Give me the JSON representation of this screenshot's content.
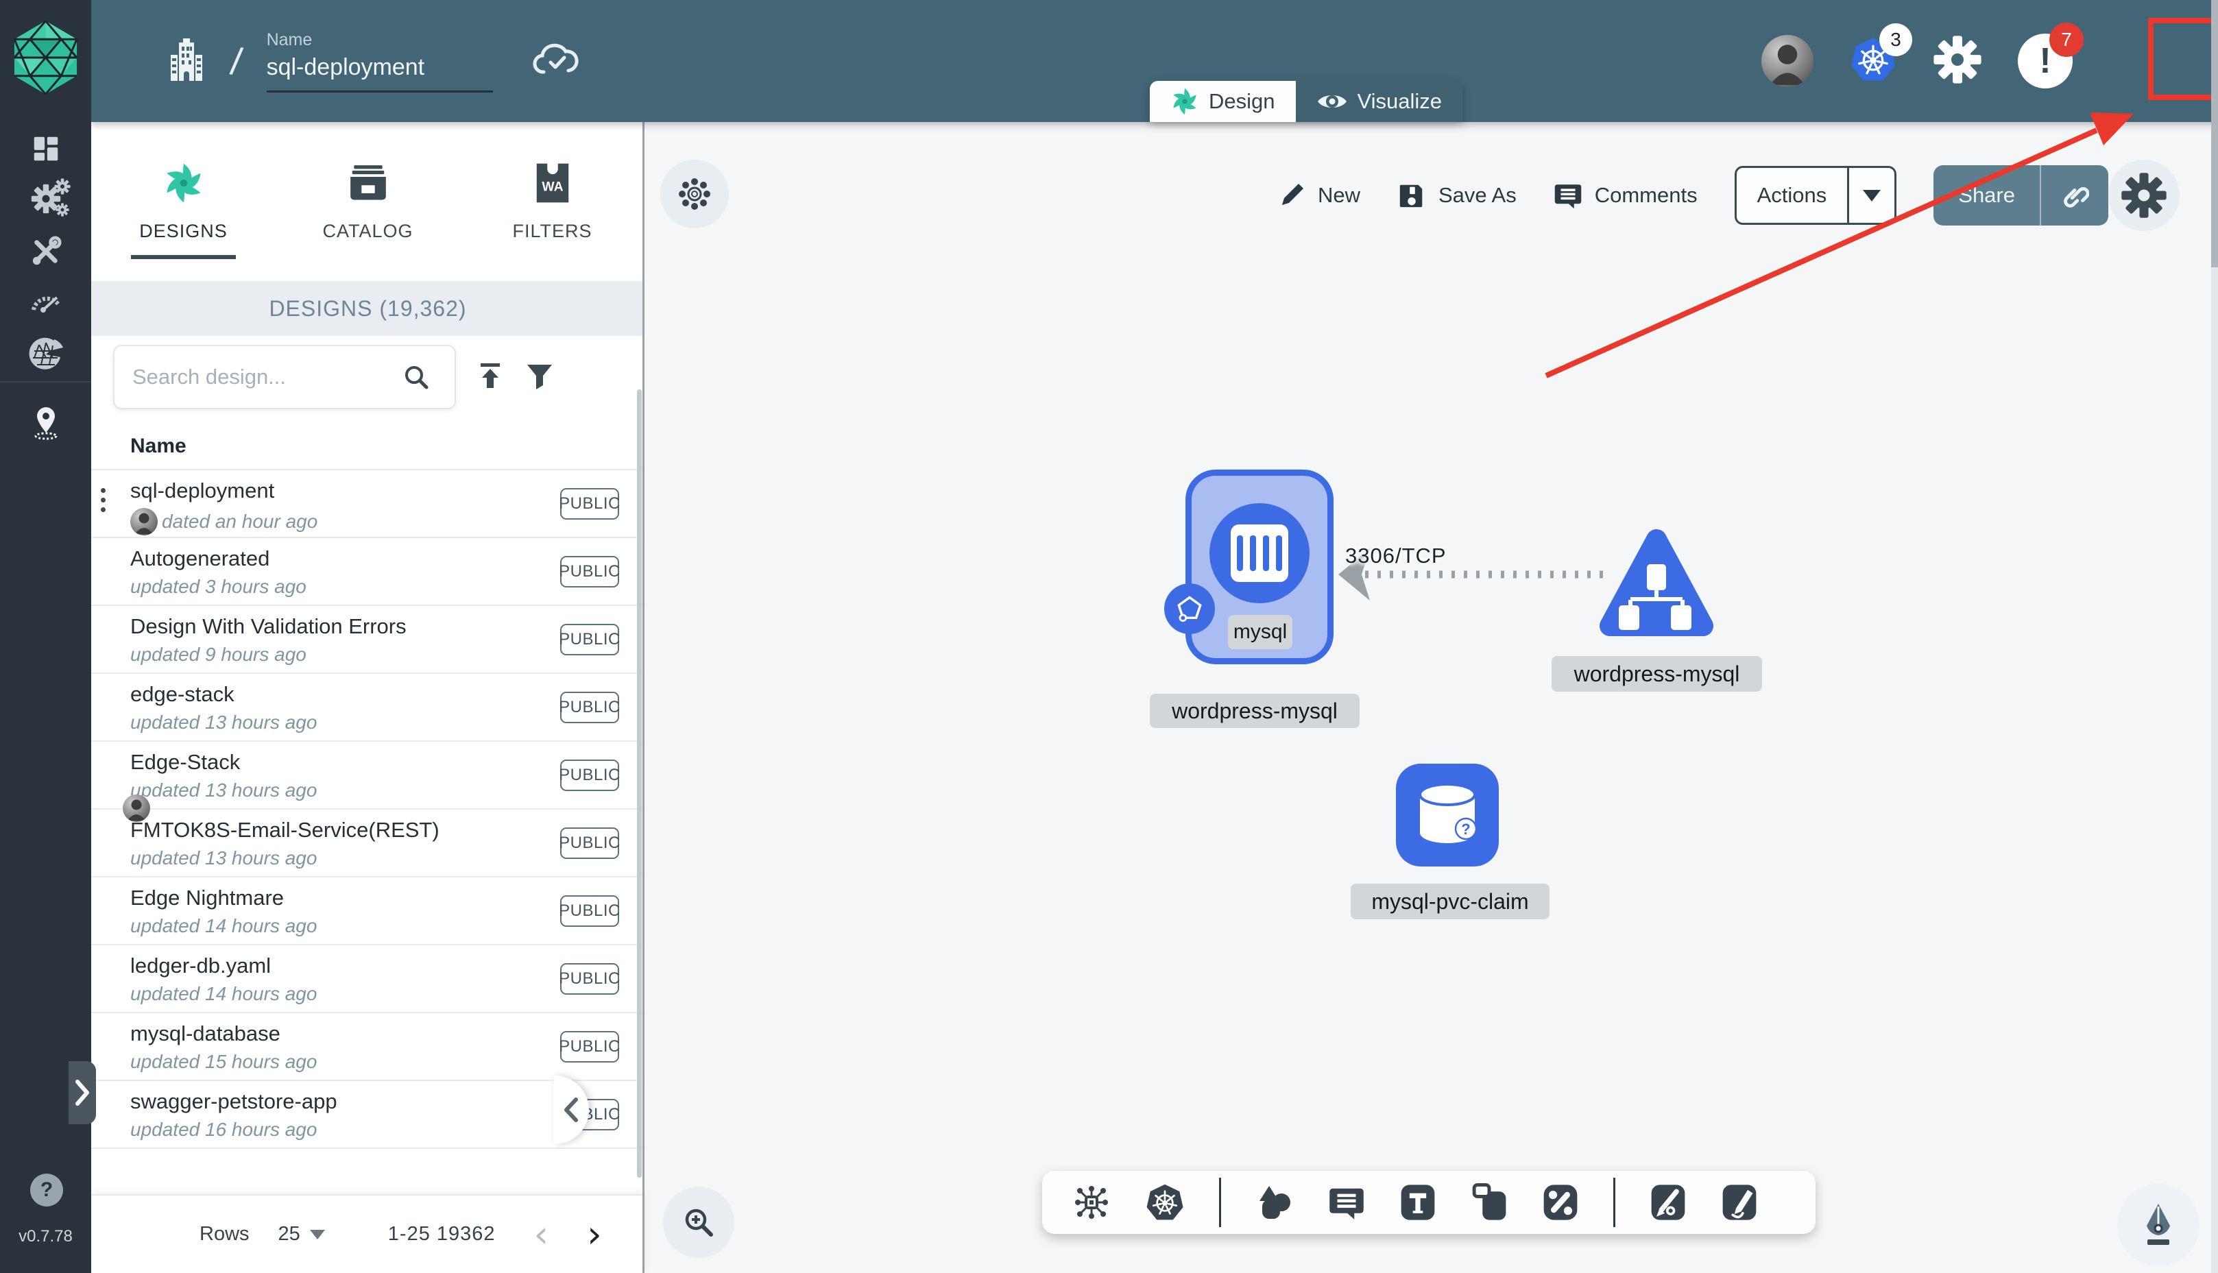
{
  "app": {
    "version": "v0.7.78"
  },
  "header": {
    "name_label": "Name",
    "design_name": "sql-deployment",
    "kubernetes_badge": "3",
    "notification_badge": "7",
    "alert_glyph": "!"
  },
  "view_tabs": {
    "design": "Design",
    "visualize": "Visualize"
  },
  "panel": {
    "tabs": [
      {
        "label": "DESIGNS"
      },
      {
        "label": "CATALOG"
      },
      {
        "label": "FILTERS"
      }
    ],
    "section_title": "DESIGNS (19,362)",
    "search_placeholder": "Search design...",
    "column_name": "Name",
    "rows": [
      {
        "name": "sql-deployment",
        "updated": "dated an hour ago",
        "badge": "PUBLIC",
        "has_menu": true,
        "has_avatar": true
      },
      {
        "name": "Autogenerated",
        "updated": "updated 3 hours ago",
        "badge": "PUBLIC"
      },
      {
        "name": "Design With Validation Errors",
        "updated": "updated 9 hours ago",
        "badge": "PUBLIC"
      },
      {
        "name": "edge-stack",
        "updated": "updated 13 hours ago",
        "badge": "PUBLIC"
      },
      {
        "name": "Edge-Stack",
        "updated": "updated 13 hours ago",
        "badge": "PUBLIC",
        "has_footer_avatar": true
      },
      {
        "name": "FMTOK8S-Email-Service(REST)",
        "updated": "updated 13 hours ago",
        "badge": "PUBLIC"
      },
      {
        "name": "Edge Nightmare",
        "updated": "updated 14 hours ago",
        "badge": "PUBLIC"
      },
      {
        "name": "ledger-db.yaml",
        "updated": "updated 14 hours ago",
        "badge": "PUBLIC"
      },
      {
        "name": "mysql-database",
        "updated": "updated 15 hours ago",
        "badge": "PUBLIC"
      },
      {
        "name": "swagger-petstore-app",
        "updated": "updated 16 hours ago",
        "badge": "PUBLIC"
      }
    ],
    "pagination": {
      "rows_label": "Rows",
      "rows_per_page": "25",
      "range": "1-25 19362"
    }
  },
  "canvas_toolbar": {
    "new": "New",
    "save_as": "Save As",
    "comments": "Comments",
    "actions": "Actions",
    "share": "Share"
  },
  "diagram": {
    "nodes": [
      {
        "id": "mysql-container",
        "label": "mysql",
        "parent_label": "wordpress-mysql",
        "type": "container"
      },
      {
        "id": "wordpress-mysql-service",
        "label": "wordpress-mysql",
        "type": "service"
      },
      {
        "id": "mysql-pvc-claim",
        "label": "mysql-pvc-claim",
        "type": "persistent-volume-claim",
        "question_glyph": "?"
      }
    ],
    "edge": {
      "label": "3306/TCP"
    }
  },
  "icons": {
    "sidebar": [
      "dashboard-icon",
      "lifecycle-gears-icon",
      "tools-icon",
      "performance-gauge-icon",
      "extensions-icon",
      "pin-icon",
      "help-icon"
    ],
    "bottom_toolbar": [
      "component-icon",
      "kubernetes-icon",
      "shapes-icon",
      "comment-icon",
      "text-tool-icon",
      "rect-tool-icon",
      "link-tool-icon",
      "pen-arrow-icon",
      "pencil-icon"
    ]
  },
  "colors": {
    "header": "#426676",
    "sidebar": "#2a323c",
    "accent_green": "#2fc7a3",
    "node_blue": "#3d6be4",
    "kubernetes_blue": "#326ce5",
    "annotation_red": "#e8392c",
    "badge_red": "#e23b32",
    "share_button": "#5d7e8e"
  }
}
